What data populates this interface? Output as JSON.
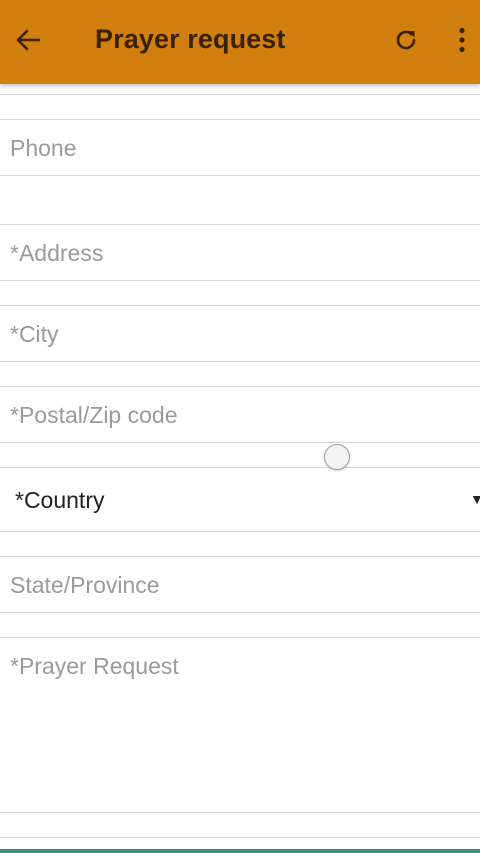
{
  "appbar": {
    "title": "Prayer request",
    "back_icon": "arrow-left-icon",
    "refresh_icon": "refresh-icon",
    "more_icon": "more-vert-icon",
    "background_color": "#d17f0e",
    "title_color": "#3a2206"
  },
  "form": {
    "phone_placeholder": "Phone",
    "address_placeholder": "*Address",
    "city_placeholder": "*City",
    "postal_placeholder": "*Postal/Zip code",
    "country_label": "*Country",
    "country_arrow": "▼",
    "state_placeholder": "State/Province",
    "prayer_placeholder": "*Prayer Request"
  }
}
